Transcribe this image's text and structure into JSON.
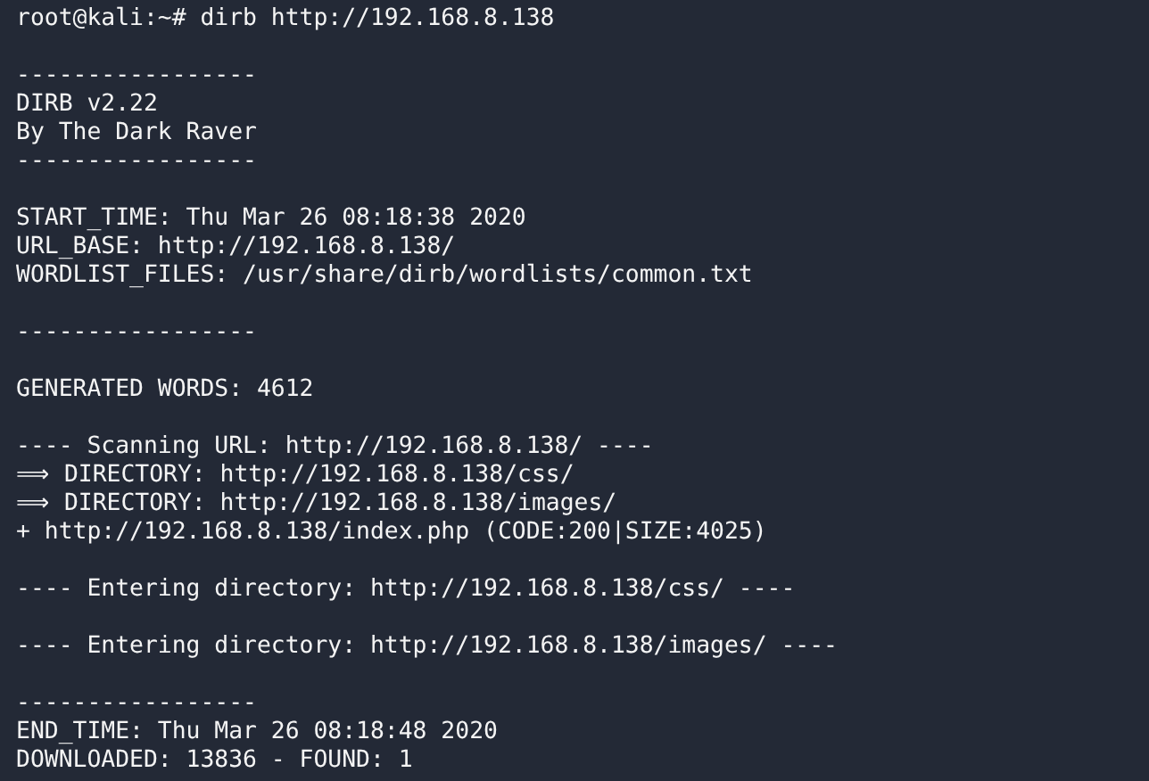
{
  "terminal": {
    "lines": [
      {
        "kind": "text",
        "text": "root@kali:~# dirb http://192.168.8.138"
      },
      {
        "kind": "blank"
      },
      {
        "kind": "text",
        "text": "-----------------"
      },
      {
        "kind": "text",
        "text": "DIRB v2.22"
      },
      {
        "kind": "text",
        "text": "By The Dark Raver"
      },
      {
        "kind": "text",
        "text": "-----------------"
      },
      {
        "kind": "blank"
      },
      {
        "kind": "text",
        "text": "START_TIME: Thu Mar 26 08:18:38 2020"
      },
      {
        "kind": "text",
        "text": "URL_BASE: http://192.168.8.138/"
      },
      {
        "kind": "text",
        "text": "WORDLIST_FILES: /usr/share/dirb/wordlists/common.txt"
      },
      {
        "kind": "blank"
      },
      {
        "kind": "text",
        "text": "-----------------"
      },
      {
        "kind": "blank"
      },
      {
        "kind": "text",
        "text": "GENERATED WORDS: 4612"
      },
      {
        "kind": "blank"
      },
      {
        "kind": "text",
        "text": "---- Scanning URL: http://192.168.8.138/ ----"
      },
      {
        "kind": "text",
        "text": "⟹ DIRECTORY: http://192.168.8.138/css/"
      },
      {
        "kind": "text",
        "text": "⟹ DIRECTORY: http://192.168.8.138/images/"
      },
      {
        "kind": "text",
        "text": "+ http://192.168.8.138/index.php (CODE:200|SIZE:4025)"
      },
      {
        "kind": "blank"
      },
      {
        "kind": "text",
        "text": "---- Entering directory: http://192.168.8.138/css/ ----"
      },
      {
        "kind": "blank"
      },
      {
        "kind": "text",
        "text": "---- Entering directory: http://192.168.8.138/images/ ----"
      },
      {
        "kind": "blank"
      },
      {
        "kind": "text",
        "text": "-----------------"
      },
      {
        "kind": "text",
        "text": "END_TIME: Thu Mar 26 08:18:48 2020"
      },
      {
        "kind": "text",
        "text": "DOWNLOADED: 13836 - FOUND: 1"
      }
    ]
  }
}
